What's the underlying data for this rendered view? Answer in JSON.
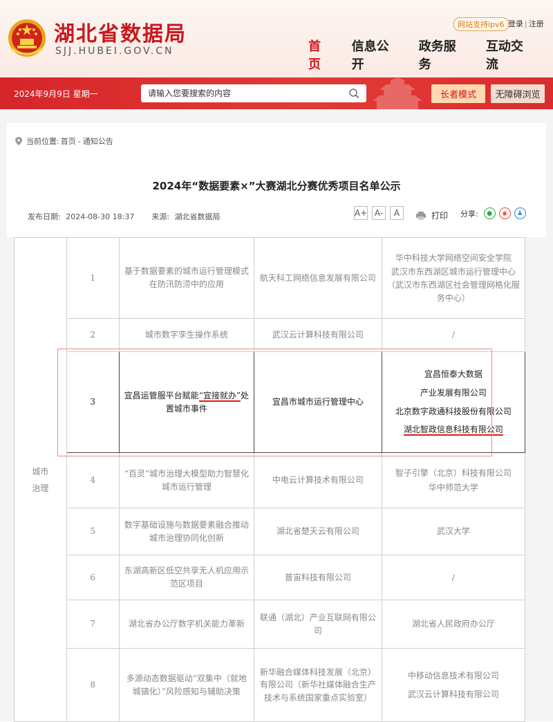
{
  "header": {
    "site_title": "湖北省数据局",
    "site_domain": "SJJ.HUBEI.GOV.CN",
    "ipv6_badge": "网站支持ipv6",
    "login": "登录",
    "separator": "|",
    "register": "注册",
    "nav": [
      "首页",
      "信息公开",
      "政务服务",
      "互动交流"
    ]
  },
  "bar": {
    "date": "2024年9月9日 星期一",
    "search_placeholder": "请输入您要搜索的内容",
    "elder_mode": "长者模式",
    "accessible": "无障碍浏览"
  },
  "breadcrumb": {
    "label": "当前位置:",
    "home": "首页",
    "sep": "-",
    "section": "通知公告"
  },
  "article": {
    "title": "2024年“数据要素×”大赛湖北分赛优秀项目名单公示",
    "publish_label": "发布日期:",
    "publish_date": "2024-08-30 18:37",
    "source_label": "来源:",
    "source": "湖北省数据局",
    "font_sizes": [
      "A+",
      "A-",
      "A"
    ],
    "print": "打印",
    "share": "分享:"
  },
  "table": {
    "category": "城市治理",
    "rows": [
      {
        "num": "1",
        "project": "基于数据要素的城市运行管理模式在防汛防涝中的应用",
        "org": "航天科工网络信息发展有限公司",
        "partners": [
          "华中科技大学网络空间安全学院",
          "武汉市东西湖区城市运行管理中心（武汉市东西湖区社会管理网格化服务中心）"
        ]
      },
      {
        "num": "2",
        "project": "城市数字孪生操作系统",
        "org": "武汉云计算科技有限公司",
        "partners": [
          "/"
        ]
      },
      {
        "num": "3",
        "project_parts": [
          "宜昌运管服平台赋能",
          "“宜接就办”",
          "处置城市事件"
        ],
        "org": "宜昌市城市运行管理中心",
        "partners": [
          "宜昌恒泰大数据",
          "产业发展有限公司",
          "北京数字政通科技股份有限公司",
          "湖北智政信息科技有限公司"
        ]
      },
      {
        "num": "4",
        "project": "“百灵”城市治理大模型助力智慧化城市运行管理",
        "org": "中电云计算技术有限公司",
        "partners": [
          "智子引擎（北京）科技有限公司",
          "华中师范大学"
        ]
      },
      {
        "num": "5",
        "project": "数字基础设施与数据要素融合推动城市治理协同化创新",
        "org": "湖北省楚天云有限公司",
        "partners": [
          "武汉大学"
        ]
      },
      {
        "num": "6",
        "project": "东湖高新区低空共享无人机应用示范区项目",
        "org": "普宙科技有限公司",
        "partners": [
          "/"
        ]
      },
      {
        "num": "7",
        "project": "湖北省办公厅数字机关能力革新",
        "org": "联通（湖北）产业互联网有限公司",
        "partners": [
          "湖北省人民政府办公厅"
        ]
      },
      {
        "num": "8",
        "project": "多源动态数据驱动“双集中（就地城镇化）”风险感知与辅助决策",
        "org": "新华融合媒体科技发展（北京）有限公司（新华社媒体融合生产技术与系统国家重点实验室）",
        "partners": [
          "中移动信息技术有限公司",
          "武汉云计算科技有限公司"
        ]
      }
    ]
  },
  "colors": {
    "brand_red": "#c8181e",
    "bar_red": "#d6252a",
    "underline_red": "#e01818"
  }
}
